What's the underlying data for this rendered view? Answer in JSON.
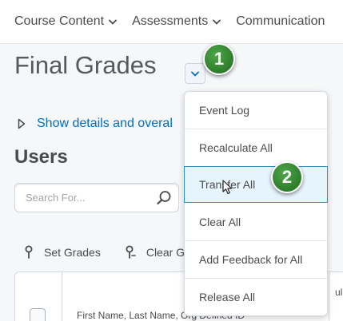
{
  "topnav": {
    "items": [
      {
        "label": "Course Content"
      },
      {
        "label": "Assessments"
      },
      {
        "label": "Communication"
      }
    ]
  },
  "page": {
    "title": "Final Grades",
    "details_link": "Show details and overal",
    "users_heading": "Users"
  },
  "search": {
    "placeholder": "Search For..."
  },
  "toolbar": {
    "set_grades": "Set Grades",
    "clear_grades": "Clear G"
  },
  "table": {
    "name_header": "First Name, Last Name, Org Defined ID",
    "right_header": "ulat"
  },
  "dropdown": {
    "items": [
      {
        "label": "Event Log"
      },
      {
        "label": "Recalculate All"
      },
      {
        "label": "Transfer All"
      },
      {
        "label": "Clear All"
      },
      {
        "label": "Add Feedback for All"
      },
      {
        "label": "Release All"
      }
    ],
    "highlighted": "Transfer All"
  },
  "callouts": {
    "first": "1",
    "second": "2"
  },
  "colors": {
    "link": "#006fbf",
    "highlight_bg": "#e6f4fb",
    "highlight_border": "#2e94c8",
    "callout_green": "#2d7d2a"
  }
}
